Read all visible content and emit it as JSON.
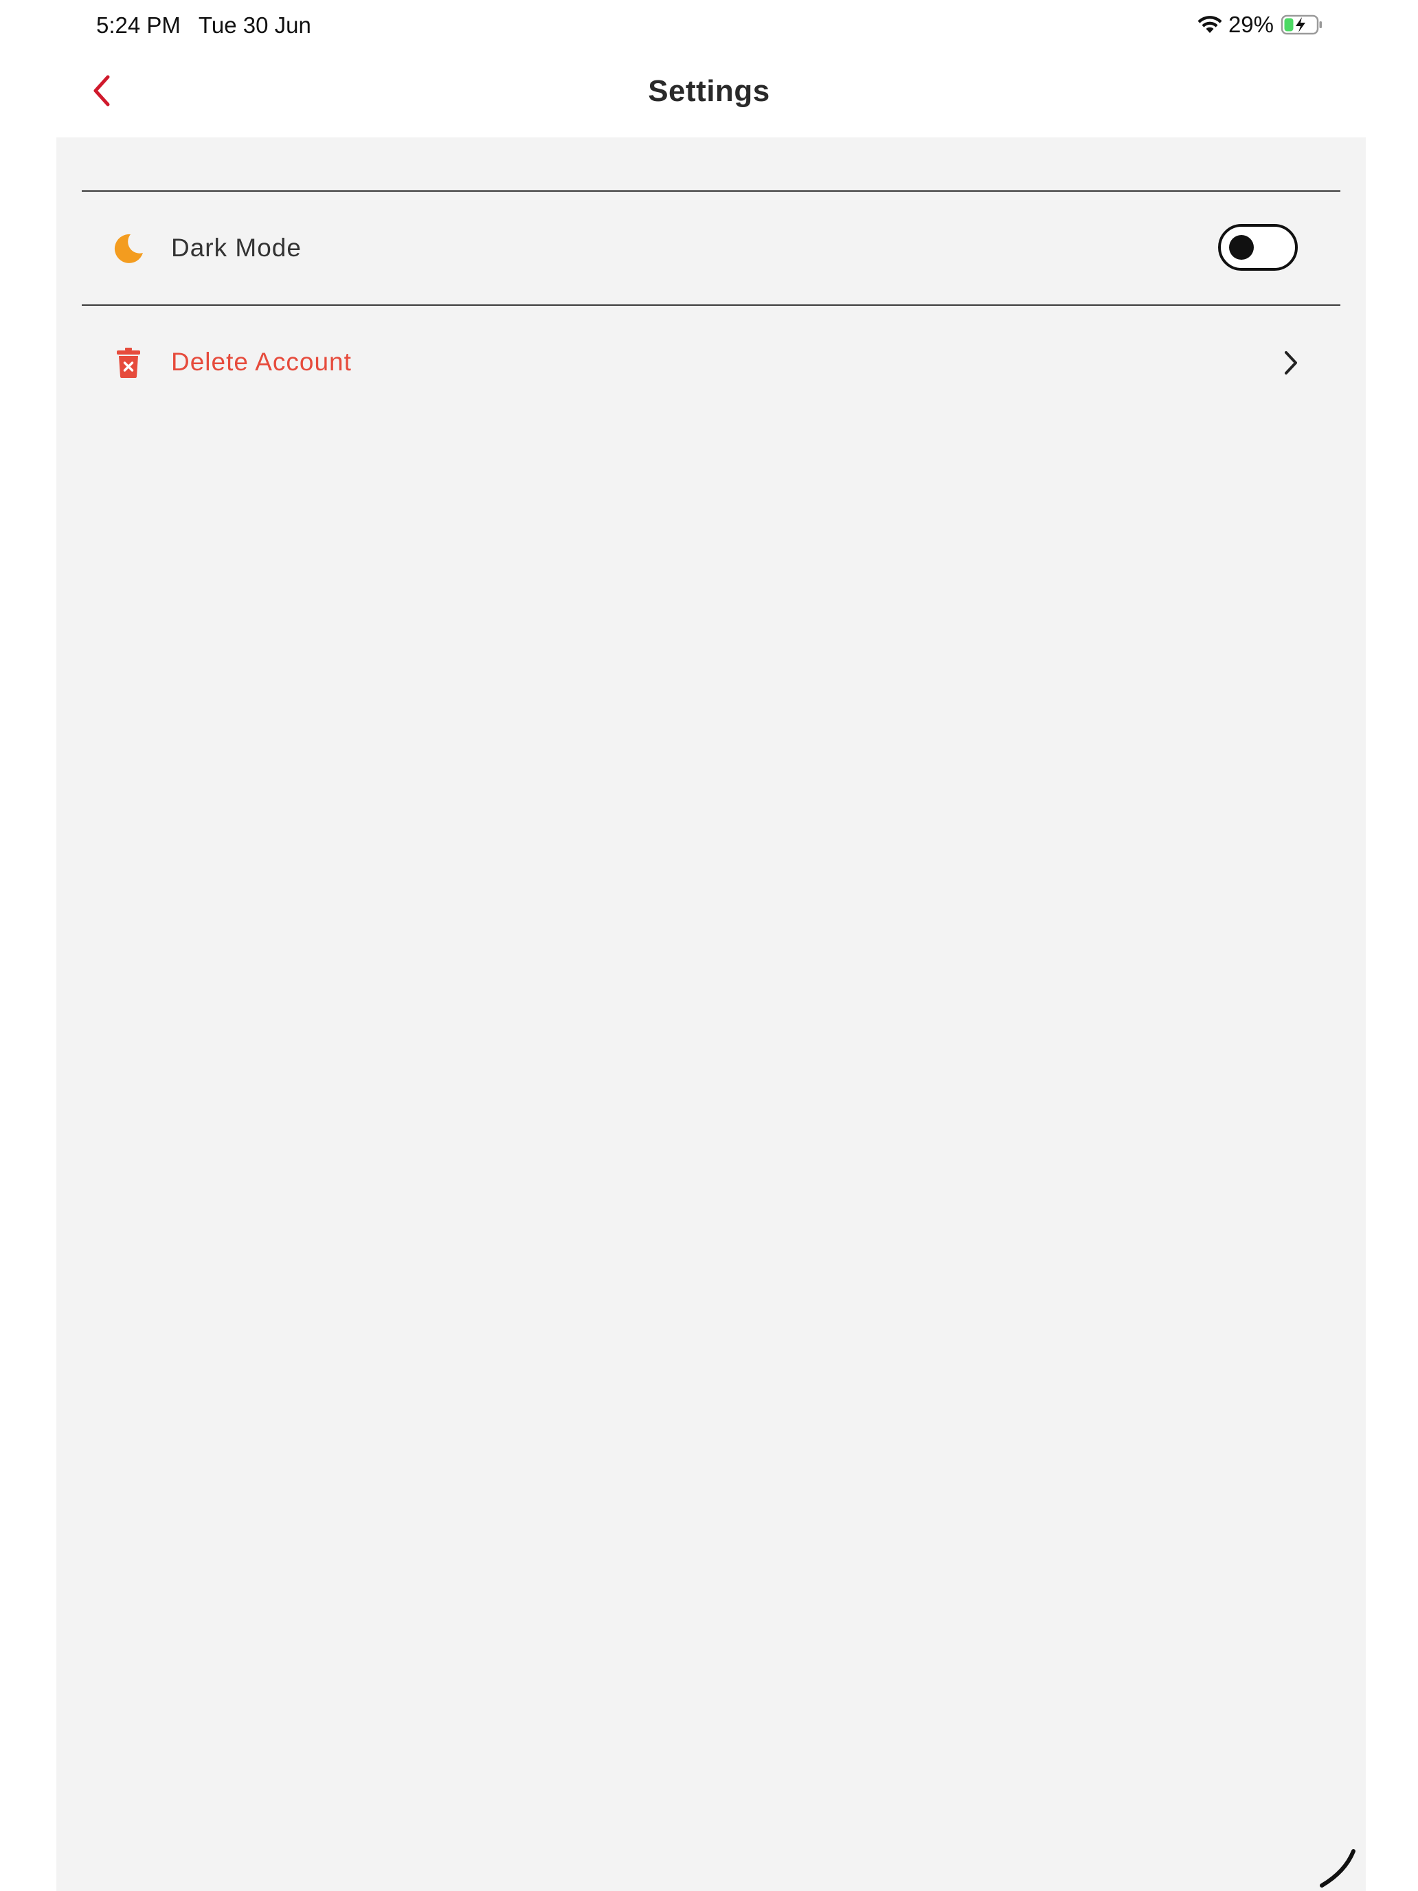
{
  "status_bar": {
    "time": "5:24 PM",
    "date": "Tue 30 Jun",
    "battery_percent": "29%",
    "battery_level": 0.29,
    "charging": true,
    "wifi_icon": "wifi-icon",
    "battery_icon": "battery-charging-icon"
  },
  "nav": {
    "title": "Settings",
    "back_icon": "chevron-left-icon",
    "accent_color": "#d0192c"
  },
  "settings": {
    "dark_mode": {
      "label": "Dark Mode",
      "icon": "moon-icon",
      "icon_color": "#f39c1f",
      "enabled": false
    },
    "delete_account": {
      "label": "Delete Account",
      "icon": "trash-icon",
      "color": "#e64b3c",
      "chevron_icon": "chevron-right-icon"
    }
  }
}
